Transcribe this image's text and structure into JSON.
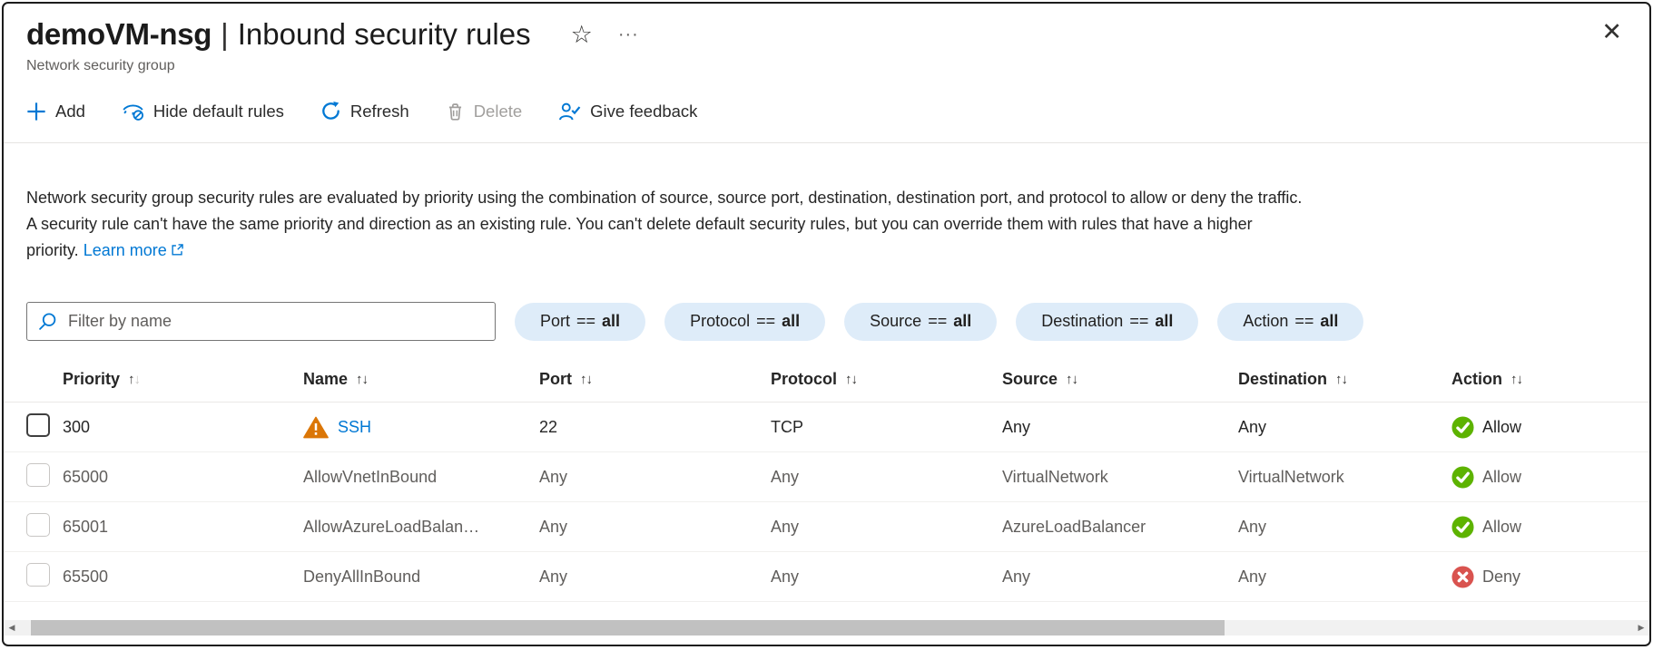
{
  "header": {
    "title_primary": "demoVM-nsg",
    "title_separator": "|",
    "title_secondary": "Inbound security rules",
    "subtitle": "Network security group"
  },
  "icons": {
    "star": "☆",
    "more": "···",
    "close": "✕",
    "sort_asc": "↑",
    "sort_desc": "↓",
    "scroll_left": "◀",
    "scroll_right": "▶"
  },
  "toolbar": {
    "items": [
      {
        "label": "Add",
        "icon": "plus-icon",
        "enabled": true
      },
      {
        "label": "Hide default rules",
        "icon": "eye-hide-icon",
        "enabled": true
      },
      {
        "label": "Refresh",
        "icon": "refresh-icon",
        "enabled": true
      },
      {
        "label": "Delete",
        "icon": "trash-icon",
        "enabled": false
      },
      {
        "label": "Give feedback",
        "icon": "person-feedback-icon",
        "enabled": true
      }
    ]
  },
  "description": {
    "lines": [
      "Network security group security rules are evaluated by priority using the combination of source, source port, destination, destination port, and protocol to allow or deny the traffic.",
      "A security rule can't have the same priority and direction as an existing rule. You can't delete default security rules, but you can override them with rules that have a higher",
      "priority."
    ],
    "learn_more": "Learn more"
  },
  "filters": {
    "search_placeholder": "Filter by name",
    "pills": [
      {
        "field": "Port",
        "op": "==",
        "value": "all"
      },
      {
        "field": "Protocol",
        "op": "==",
        "value": "all"
      },
      {
        "field": "Source",
        "op": "==",
        "value": "all"
      },
      {
        "field": "Destination",
        "op": "==",
        "value": "all"
      },
      {
        "field": "Action",
        "op": "==",
        "value": "all"
      }
    ]
  },
  "table": {
    "columns": [
      {
        "label": "Priority"
      },
      {
        "label": "Name"
      },
      {
        "label": "Port"
      },
      {
        "label": "Protocol"
      },
      {
        "label": "Source"
      },
      {
        "label": "Destination"
      },
      {
        "label": "Action"
      }
    ],
    "rows": [
      {
        "priority": "300",
        "name": "SSH",
        "port": "22",
        "protocol": "TCP",
        "source": "Any",
        "destination": "Any",
        "action": "Allow"
      },
      {
        "priority": "65000",
        "name": "AllowVnetInBound",
        "port": "Any",
        "protocol": "Any",
        "source": "VirtualNetwork",
        "destination": "VirtualNetwork",
        "action": "Allow"
      },
      {
        "priority": "65001",
        "name": "AllowAzureLoadBalan…",
        "port": "Any",
        "protocol": "Any",
        "source": "AzureLoadBalancer",
        "destination": "Any",
        "action": "Allow"
      },
      {
        "priority": "65500",
        "name": "DenyAllInBound",
        "port": "Any",
        "protocol": "Any",
        "source": "Any",
        "destination": "Any",
        "action": "Deny"
      }
    ]
  },
  "colors": {
    "accent_blue": "#0078d4",
    "pill_background": "#deecf9",
    "warning_orange": "#db7607",
    "allow_green": "#5db300",
    "deny_red": "#d9534f",
    "text_muted": "#605e5c"
  }
}
